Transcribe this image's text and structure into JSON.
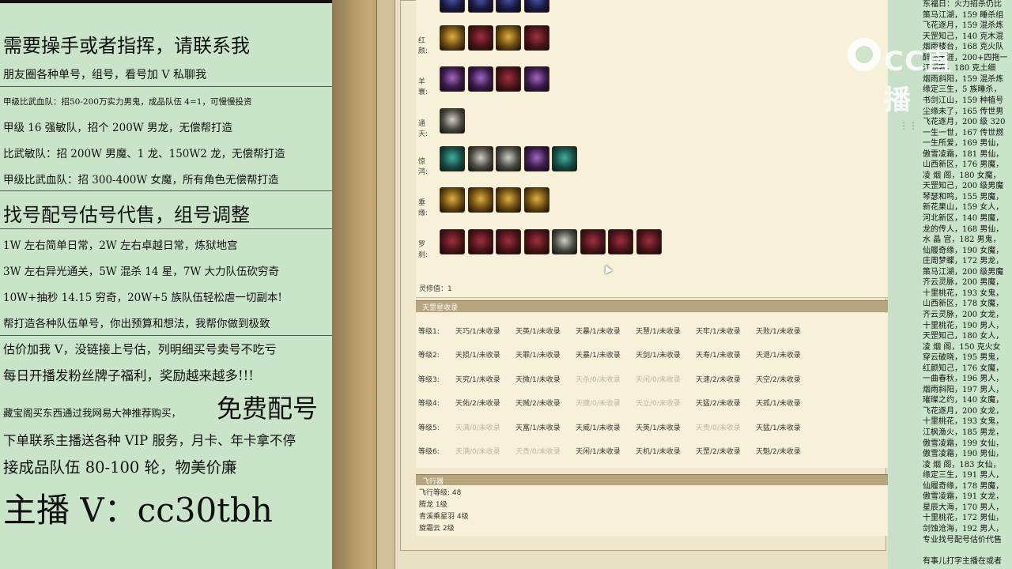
{
  "promo": {
    "heading1": "需要操手或者指挥，请联系我",
    "line_wechat": "朋友圈各种单号，组号，看号加 V 私聊我",
    "line_a1": "甲级比武血队：招50-200万实力男鬼，成品队伍 4=1，可慢慢投资",
    "line_a2": "甲级 16 强敏队，招个 200W 男龙，无偿帮打造",
    "line_a3": "比武敏队：招 200W 男魔、1 龙、150W2 龙，无偿帮打造",
    "line_a4": "甲级比武血队：招 300-400W 女魔，所有角色无偿帮打造",
    "heading2": "找号配号估号代售，组号调整",
    "line_b1": "1W 左右简单日常，2W 左右卓越日常，炼狱地宫",
    "line_b2": "3W 左右异光通关，5W 混杀 14 星，7W 大力队伍砍穷奇",
    "line_b3": "10W+抽秒 14.15 穷奇，20W+5 族队伍轻松虐一切副本!",
    "line_b4": "帮打造各种队伍单号，你出预算和想法，我帮你做到极致",
    "line_c1": "估价加我 V，没链接上号估，列明细买号卖号不吃亏",
    "line_c2": "每日开播发粉丝牌子福利，奖励越来越多!!!",
    "line_c3_small": "藏宝阁买东西通过我网易大神推荐购买，",
    "line_c3_big": "免费配号",
    "line_c4": "下单联系主播送各种 VIP 服务，月卡、年卡拿不停",
    "line_c5": "接成品队伍 80-100 轮，物美价廉",
    "anchor": "主播 V：cc30tbh"
  },
  "gear": {
    "rows": [
      {
        "label": "",
        "icons": [
          "blue",
          "blue",
          "blue",
          "blue"
        ]
      },
      {
        "label": "红颜:",
        "icons": [
          "gold",
          "red",
          "gold",
          "red"
        ]
      },
      {
        "label": "羊寰:",
        "icons": [
          "purple",
          "purple",
          "red",
          "purple"
        ]
      },
      {
        "label": "通天:",
        "icons": [
          "silver"
        ]
      },
      {
        "label": "惊鸿:",
        "icons": [
          "teal",
          "silver",
          "silver",
          "purple",
          "teal"
        ]
      },
      {
        "label": "垂缘:",
        "icons": [
          "gold",
          "gold",
          "gold",
          "gold"
        ]
      },
      {
        "label": "罗刹:",
        "icons": [
          "red",
          "red",
          "red",
          "red",
          "silver",
          "red",
          "red",
          "red"
        ]
      }
    ],
    "lingxiu": "灵修值：1"
  },
  "tianzhao": {
    "title": "天罡星收录",
    "rows": [
      {
        "label": "等级1:",
        "cells": [
          {
            "t": "天巧/1/未收录",
            "dim": false
          },
          {
            "t": "天英/1/未收录",
            "dim": false
          },
          {
            "t": "天暴/1/未收录",
            "dim": false
          },
          {
            "t": "天慧/1/未收录",
            "dim": false
          },
          {
            "t": "天牢/1/未收录",
            "dim": false
          },
          {
            "t": "天败/1/未收录",
            "dim": false
          }
        ]
      },
      {
        "label": "等级2:",
        "cells": [
          {
            "t": "天损/1/未收录",
            "dim": false
          },
          {
            "t": "天罪/1/未收录",
            "dim": false
          },
          {
            "t": "天暴/1/未收录",
            "dim": false
          },
          {
            "t": "天剑/1/未收录",
            "dim": false
          },
          {
            "t": "天寿/1/未收录",
            "dim": false
          },
          {
            "t": "天退/1/未收录",
            "dim": false
          }
        ]
      },
      {
        "label": "等级3:",
        "cells": [
          {
            "t": "天究/1/未收录",
            "dim": false
          },
          {
            "t": "天微/1/未收录",
            "dim": false
          },
          {
            "t": "天杀/0/未收录",
            "dim": true
          },
          {
            "t": "天闲/0/未收录",
            "dim": true
          },
          {
            "t": "天速/2/未收录",
            "dim": false
          },
          {
            "t": "天空/2/未收录",
            "dim": false
          }
        ]
      },
      {
        "label": "等级4:",
        "cells": [
          {
            "t": "天佑/2/未收录",
            "dim": false
          },
          {
            "t": "天贼/2/未收录",
            "dim": false
          },
          {
            "t": "天捷/0/未收录",
            "dim": true
          },
          {
            "t": "天立/0/未收录",
            "dim": true
          },
          {
            "t": "天猛/2/未收录",
            "dim": false
          },
          {
            "t": "天孤/1/未收录",
            "dim": false
          }
        ]
      },
      {
        "label": "等级5:",
        "cells": [
          {
            "t": "天满/0/未收录",
            "dim": true
          },
          {
            "t": "天富/1/未收录",
            "dim": false
          },
          {
            "t": "天威/1/未收录",
            "dim": false
          },
          {
            "t": "天英/1/未收录",
            "dim": false
          },
          {
            "t": "天贵/0/未收录",
            "dim": true
          },
          {
            "t": "天猛/1/未收录",
            "dim": false
          }
        ]
      },
      {
        "label": "等级6:",
        "cells": [
          {
            "t": "天满/0/未收录",
            "dim": true
          },
          {
            "t": "天贵/0/未收录",
            "dim": true
          },
          {
            "t": "天闲/1/未收录",
            "dim": false
          },
          {
            "t": "天机/1/未收录",
            "dim": false
          },
          {
            "t": "天罡/2/未收录",
            "dim": false
          },
          {
            "t": "天魁/2/未收录",
            "dim": false
          }
        ]
      }
    ]
  },
  "flight": {
    "title": "飞行器",
    "lines": [
      "飞行等级: 48",
      "腾龙  1级",
      "青溪乘星羽  4级",
      "旋霜云  2级"
    ]
  },
  "overlay": {
    "logo_text": "CC直播",
    "dots": "⋮⋮"
  },
  "roster": {
    "lines": [
      "东福日：火力招杀仍比",
      "策马江湖，159 睡杀组",
      "飞花逐月，159 混杀炼",
      "天罡知己，140 克木混",
      "烟雨楼台，168 克火队",
      "醉卧天涯，200+四拖一",
      "江湖客，180 克土细",
      "烟雨斜阳，159 混杀炼",
      "缘定三生，5 族睡杀，",
      "书剑江山，159 种植号",
      "尘缘未了，165 传世男",
      "飞花逐月，200 级 320",
      "一生一世，167 传世燃",
      "一生所爱，169 男仙，",
      "傲雪凌霜，181 男仙，",
      "山西新区，176 男魔，",
      "凌 烟 阁，180 女魔，",
      "天罡知己，200 级男魔",
      "琴瑟和鸣，155 男魔，",
      "新花果山，159 女人，",
      "河北新区，140 男魔，",
      "龙的传人，168 男仙，",
      "水 晶 宫，182 男鬼，",
      "仙履奇缘，190 女魔，",
      "庄周梦蝶，172 男龙，",
      "策马江湖，200 级男魔",
      "齐云灵脉，200 男魔，",
      "十里桃花，193 女鬼，",
      "山西新区，178 女魔，",
      "齐云灵脉，200 女龙，",
      "十里桃花，190 男人，",
      "天罡知己，180 女人，",
      "凌 烟 阁，150 克火女",
      "穿云破晓，195 男鬼，",
      "红颜知己，176 女魔，",
      "一曲春秋，196 男人，",
      "烟雨斜阳，197 男人，",
      "璀璨之约，140 女魔，",
      "飞花逐月，200 女龙，",
      "十里桃花，193 女鬼，",
      "江枫渔火，185 男龙，",
      "傲雪凌霜，199 女仙，",
      "傲雪凌霜，190 男仙，",
      "凌 烟 阁，183 女仙，",
      "缘定三生，191 男人，",
      "仙履奇缘，178 男魔，",
      "傲雪凌霜，191 女龙，",
      "星辰大海，170 男人，",
      "十里桃花，172 男仙，",
      "剑蚀沧海，192 男人，",
      "专业找号配号估价代售",
      "",
      "有事儿打字主播在或者"
    ]
  }
}
